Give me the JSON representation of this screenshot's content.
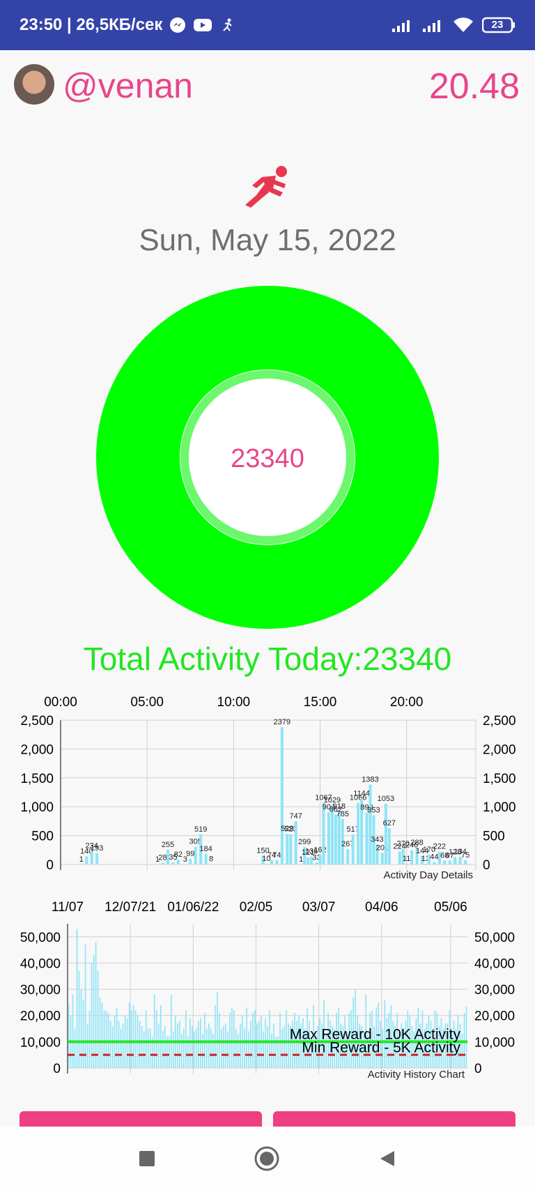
{
  "status_bar": {
    "time_speed": "23:50 | 26,5КБ/сек",
    "battery": "23",
    "icons": [
      "messenger-icon",
      "youtube-icon",
      "runner-icon",
      "signal-icon",
      "signal-icon",
      "wifi-icon",
      "battery-icon"
    ]
  },
  "header": {
    "username": "@venan",
    "balance": "20.48"
  },
  "day": {
    "date": "Sun, May 15, 2022",
    "steps": "23340",
    "total_label": "Total Activity Today:23340"
  },
  "colors": {
    "accent": "#e8458b",
    "ring": "#00ff00",
    "bars": "#8ee4f7",
    "max_line": "#22e622",
    "min_line": "#cc2222"
  },
  "chart_data": [
    {
      "type": "bar",
      "description_label": "Activity Day Details",
      "x_tick_labels": [
        "00:00",
        "05:00",
        "10:00",
        "15:00",
        "20:00"
      ],
      "y_tick_labels": [
        "0",
        "500",
        "1,000",
        "1,500",
        "2,000",
        "2,500"
      ],
      "xlim": [
        0,
        24
      ],
      "ylim": [
        0,
        2500
      ],
      "bars": [
        {
          "t": 1.2,
          "v": 1
        },
        {
          "t": 1.5,
          "v": 140
        },
        {
          "t": 1.8,
          "v": 234
        },
        {
          "t": 2.1,
          "v": 193
        },
        {
          "t": 5.6,
          "v": 1
        },
        {
          "t": 5.9,
          "v": 28
        },
        {
          "t": 6.2,
          "v": 255
        },
        {
          "t": 6.5,
          "v": 35
        },
        {
          "t": 6.8,
          "v": 82
        },
        {
          "t": 7.2,
          "v": 3
        },
        {
          "t": 7.5,
          "v": 99
        },
        {
          "t": 7.8,
          "v": 305
        },
        {
          "t": 8.1,
          "v": 519
        },
        {
          "t": 8.4,
          "v": 184
        },
        {
          "t": 8.7,
          "v": 8
        },
        {
          "t": 11.7,
          "v": 150
        },
        {
          "t": 11.9,
          "v": 10
        },
        {
          "t": 12.2,
          "v": 74
        },
        {
          "t": 12.5,
          "v": 74
        },
        {
          "t": 12.8,
          "v": 2379
        },
        {
          "t": 13.1,
          "v": 529
        },
        {
          "t": 13.3,
          "v": 523
        },
        {
          "t": 13.6,
          "v": 747
        },
        {
          "t": 13.9,
          "v": 1
        },
        {
          "t": 14.1,
          "v": 299
        },
        {
          "t": 14.3,
          "v": 121
        },
        {
          "t": 14.5,
          "v": 136
        },
        {
          "t": 14.8,
          "v": 33
        },
        {
          "t": 15.0,
          "v": 162
        },
        {
          "t": 15.2,
          "v": 1067
        },
        {
          "t": 15.5,
          "v": 904
        },
        {
          "t": 15.7,
          "v": 1029
        },
        {
          "t": 15.9,
          "v": 862
        },
        {
          "t": 16.1,
          "v": 918
        },
        {
          "t": 16.3,
          "v": 785
        },
        {
          "t": 16.6,
          "v": 267
        },
        {
          "t": 16.9,
          "v": 517
        },
        {
          "t": 17.2,
          "v": 1066
        },
        {
          "t": 17.4,
          "v": 1144
        },
        {
          "t": 17.7,
          "v": 898
        },
        {
          "t": 17.9,
          "v": 1383
        },
        {
          "t": 18.1,
          "v": 853
        },
        {
          "t": 18.3,
          "v": 343
        },
        {
          "t": 18.6,
          "v": 201
        },
        {
          "t": 18.8,
          "v": 1053
        },
        {
          "t": 19.0,
          "v": 627
        },
        {
          "t": 19.6,
          "v": 224
        },
        {
          "t": 19.8,
          "v": 270
        },
        {
          "t": 20.0,
          "v": 11
        },
        {
          "t": 20.3,
          "v": 246
        },
        {
          "t": 20.6,
          "v": 288
        },
        {
          "t": 20.9,
          "v": 144
        },
        {
          "t": 21.1,
          "v": 13
        },
        {
          "t": 21.3,
          "v": 170
        },
        {
          "t": 21.6,
          "v": 44
        },
        {
          "t": 21.9,
          "v": 222
        },
        {
          "t": 22.2,
          "v": 68
        },
        {
          "t": 22.5,
          "v": 67
        },
        {
          "t": 22.8,
          "v": 128
        },
        {
          "t": 23.1,
          "v": 134
        },
        {
          "t": 23.4,
          "v": 75
        }
      ]
    },
    {
      "type": "bar",
      "description_label": "Activity History Chart",
      "x_tick_labels": [
        "11/07",
        "12/07/21",
        "01/06/22",
        "02/05",
        "03/07",
        "04/06",
        "05/06"
      ],
      "y_tick_labels": [
        "0",
        "10,000",
        "20,000",
        "30,000",
        "40,000",
        "50,000"
      ],
      "ylim": [
        0,
        55000
      ],
      "limit_lines": [
        {
          "label": "Max Reward - 10K Activity",
          "value": 10000,
          "style": "solid"
        },
        {
          "label": "Min Reward - 5K Activity",
          "value": 5000,
          "style": "dashed"
        }
      ],
      "values": [
        24000,
        20000,
        28000,
        15000,
        53000,
        37000,
        30000,
        26000,
        47000,
        17000,
        22000,
        40000,
        43000,
        48000,
        37000,
        27000,
        25000,
        22000,
        22000,
        21000,
        18000,
        16000,
        20000,
        23000,
        18000,
        15000,
        17000,
        20000,
        19000,
        25000,
        22000,
        24000,
        22000,
        20000,
        18000,
        16000,
        14000,
        22000,
        15000,
        15000,
        12000,
        28000,
        22000,
        17000,
        24000,
        14000,
        16000,
        12000,
        12000,
        28000,
        14000,
        20000,
        17000,
        18000,
        13000,
        15000,
        22000,
        12000,
        19000,
        16000,
        14000,
        15000,
        18000,
        19000,
        13000,
        21000,
        15000,
        17000,
        15000,
        13000,
        24000,
        29000,
        21000,
        15000,
        16000,
        17000,
        14000,
        21000,
        23000,
        22000,
        15000,
        13000,
        17000,
        20000,
        15000,
        23000,
        14000,
        18000,
        21000,
        22000,
        17000,
        18000,
        20000,
        14000,
        19000,
        16000,
        22000,
        13000,
        17000,
        12000,
        12000,
        21000,
        15000,
        16000,
        22000,
        17000,
        16000,
        18000,
        21000,
        18000,
        20000,
        17000,
        19000,
        15000,
        23000,
        18000,
        12000,
        24000,
        13000,
        16000,
        19000,
        17000,
        26000,
        13000,
        21000,
        18000,
        16000,
        15000,
        21000,
        23000,
        17000,
        16000,
        20000,
        14000,
        21000,
        22000,
        27000,
        30000,
        20000,
        17000,
        16000,
        14000,
        28000,
        14000,
        21000,
        22000,
        16000,
        23000,
        25000,
        18000,
        15000,
        26000,
        19000,
        21000,
        24000,
        18000,
        16000,
        21000,
        14000,
        17000,
        15000,
        18000,
        22000,
        20000,
        16000,
        14000,
        19000,
        23000,
        17000,
        22000,
        15000,
        17000,
        20000,
        18000,
        14000,
        22000,
        21000,
        16000,
        19000,
        15000,
        17000,
        17000,
        22000,
        14000,
        18000,
        15000,
        20000,
        17000,
        13000,
        21000,
        23340
      ]
    }
  ]
}
